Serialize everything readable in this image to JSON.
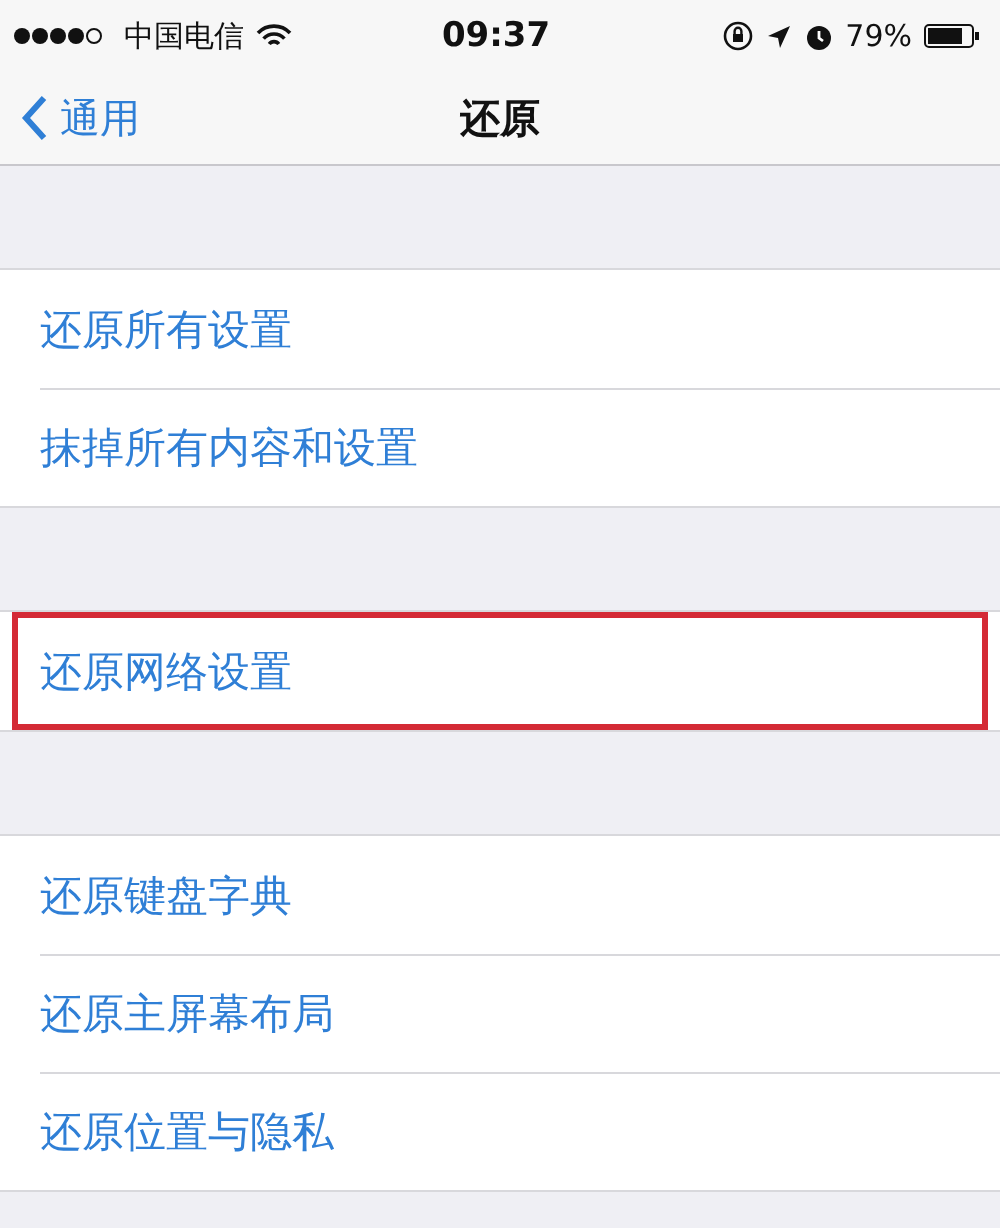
{
  "status_bar": {
    "carrier": "中国电信",
    "time": "09:37",
    "battery_percent": "79%"
  },
  "nav_bar": {
    "back_label": "通用",
    "title": "还原"
  },
  "groups": [
    {
      "rows": [
        {
          "label": "还原所有设置",
          "highlighted": false
        },
        {
          "label": "抹掉所有内容和设置",
          "highlighted": false
        }
      ]
    },
    {
      "rows": [
        {
          "label": "还原网络设置",
          "highlighted": true
        }
      ]
    },
    {
      "rows": [
        {
          "label": "还原键盘字典",
          "highlighted": false
        },
        {
          "label": "还原主屏幕布局",
          "highlighted": false
        },
        {
          "label": "还原位置与隐私",
          "highlighted": false
        }
      ]
    }
  ]
}
